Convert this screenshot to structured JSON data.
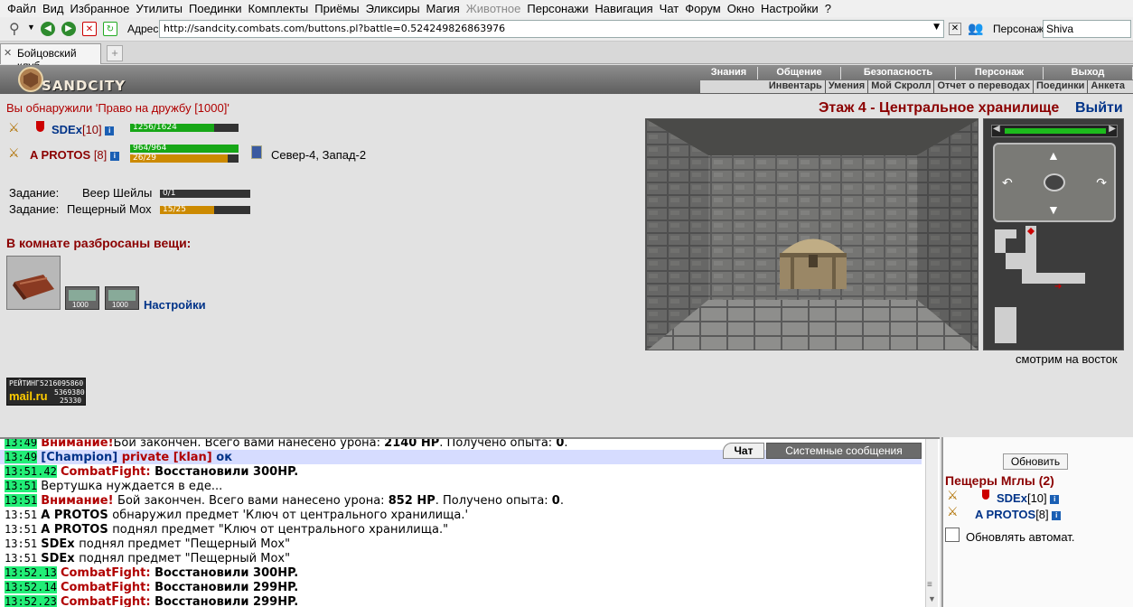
{
  "menu": [
    "Файл",
    "Вид",
    "Избранное",
    "Утилиты",
    "Поединки",
    "Комплекты",
    "Приёмы",
    "Эликсиры",
    "Магия",
    "Животное",
    "Персонажи",
    "Навигация",
    "Чат",
    "Форум",
    "Окно",
    "Настройки",
    "?"
  ],
  "menu_disabled_index": 9,
  "toolbar": {
    "address_label": "Адрес:",
    "address": "http://sandcity.combats.com/buttons.pl?battle=0.524249826863976",
    "character_label": "Персонаж:",
    "character": "Shiva"
  },
  "tab": {
    "title": "Бойцовский клуб"
  },
  "header": {
    "logo": "SANDCITY",
    "nav_top": [
      "Знания",
      "Общение",
      "Безопасность",
      "Персонаж",
      "Выход"
    ],
    "nav_bottom": [
      "Инвентарь",
      "Умения",
      "Мой Скролл",
      "Отчет о переводах",
      "Поединки",
      "Анкета"
    ]
  },
  "main": {
    "discovery": "Вы обнаружили 'Право на дружбу [1000]'",
    "players": [
      {
        "name": "SDEx",
        "level": "[10]",
        "hp_text": "1256/1624",
        "hp_frac": 0.773
      },
      {
        "name": "A PROTOS",
        "level": "[8]",
        "hp_text": "964/964",
        "hp_frac": 1.0,
        "mana_text": "26/29",
        "mana_frac": 0.897
      }
    ],
    "location": "Север-4, Запад-2",
    "tasks": [
      {
        "label": "Задание:",
        "name": "Веер Шейлы",
        "progress_text": "0/1",
        "progress_frac": 0.0
      },
      {
        "label": "Задание:",
        "name": "Пещерный Мох",
        "progress_text": "15/25",
        "progress_frac": 0.6
      }
    ],
    "items_heading": "В комнате разбросаны вещи:",
    "scroll_value": "1000",
    "settings_link": "Настройки",
    "floor_title": "Этаж 4 - Центральное хранилище",
    "exit_link": "Выйти",
    "looking": "смотрим на восток",
    "counter": {
      "label": "РЕЙТИНГ",
      "n1": "5216095860",
      "n2": "5369380",
      "n3": "25330",
      "brand": "mail.ru"
    }
  },
  "chat": {
    "tab_chat": "Чат",
    "tab_system": "Системные сообщения",
    "lines": [
      {
        "ts": "13:49",
        "green": true,
        "parts": [
          [
            "red",
            "Внимание!"
          ],
          [
            "",
            "Бой закончен. Всего вами нанесено урона: "
          ],
          [
            "b",
            "2140 HP"
          ],
          [
            "",
            ". Получено опыта: "
          ],
          [
            "b",
            "0"
          ],
          [
            "",
            "."
          ]
        ]
      },
      {
        "ts": "13:49",
        "green": true,
        "hl": true,
        "parts": [
          [
            "blue",
            "[Champion] "
          ],
          [
            "red",
            "private [klan] "
          ],
          [
            "blue",
            "ок"
          ]
        ]
      },
      {
        "ts": "13:51.42",
        "green": true,
        "parts": [
          [
            "red",
            "CombatFight: "
          ],
          [
            "b",
            "Восстановили 300HP."
          ]
        ]
      },
      {
        "ts": "13:51",
        "green": true,
        "parts": [
          [
            "",
            "Вертушка нуждается в еде..."
          ]
        ]
      },
      {
        "ts": "13:51",
        "green": true,
        "parts": [
          [
            "red",
            "Внимание! "
          ],
          [
            "",
            "Бой закончен. Всего вами нанесено урона: "
          ],
          [
            "b",
            "852 HP"
          ],
          [
            "",
            ". Получено опыта: "
          ],
          [
            "b",
            "0"
          ],
          [
            "",
            "."
          ]
        ]
      },
      {
        "ts": "13:51",
        "green": false,
        "parts": [
          [
            "b",
            "A PROTOS "
          ],
          [
            "",
            "обнаружил предмет 'Ключ от центрального хранилища.'"
          ]
        ]
      },
      {
        "ts": "13:51",
        "green": false,
        "parts": [
          [
            "b",
            "A PROTOS "
          ],
          [
            "",
            "поднял предмет \"Ключ от центрального хранилища.\""
          ]
        ]
      },
      {
        "ts": "13:51",
        "green": false,
        "parts": [
          [
            "b",
            "SDEx "
          ],
          [
            "",
            "поднял предмет \"Пещерный Мох\""
          ]
        ]
      },
      {
        "ts": "13:51",
        "green": false,
        "parts": [
          [
            "b",
            "SDEx "
          ],
          [
            "",
            "поднял предмет \"Пещерный Мох\""
          ]
        ]
      },
      {
        "ts": "13:52.13",
        "green": true,
        "parts": [
          [
            "red",
            "CombatFight: "
          ],
          [
            "b",
            "Восстановили 300HP."
          ]
        ]
      },
      {
        "ts": "13:52.14",
        "green": true,
        "parts": [
          [
            "red",
            "CombatFight: "
          ],
          [
            "b",
            "Восстановили 299HP."
          ]
        ]
      },
      {
        "ts": "13:52.23",
        "green": true,
        "parts": [
          [
            "red",
            "CombatFight: "
          ],
          [
            "b",
            "Восстановили 299HP."
          ]
        ]
      }
    ]
  },
  "right_panel": {
    "refresh": "Обновить",
    "room": "Пещеры Мглы (2)",
    "members": [
      {
        "name": "SDEx",
        "level": "[10]"
      },
      {
        "name": "A PROTOS",
        "level": "[8]"
      }
    ],
    "auto_refresh": "Обновлять автомат."
  },
  "colors": {
    "hp": "#17a717",
    "mana": "#cc8a00",
    "red": "#b00000",
    "blue": "#003388",
    "ts_green": "#22ee77"
  }
}
